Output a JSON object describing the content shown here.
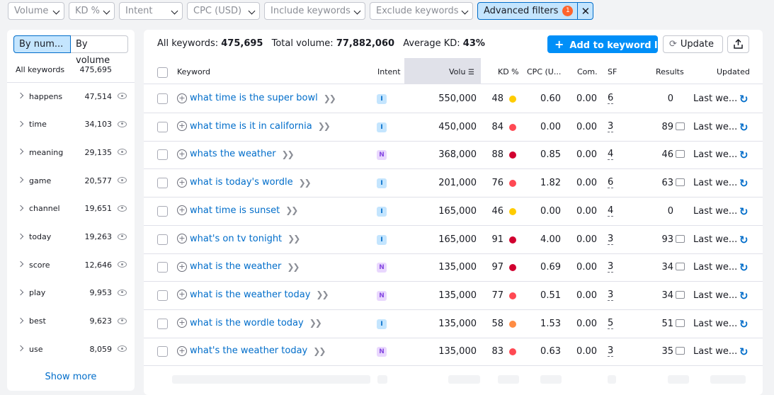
{
  "filters": {
    "volume": "Volume",
    "kd": "KD %",
    "intent": "Intent",
    "cpc": "CPC (USD)",
    "include": "Include keywords",
    "exclude": "Exclude keywords",
    "advanced": "Advanced filters",
    "advanced_count": "1"
  },
  "sidebar": {
    "by_number": "By num...",
    "by_volume": "By volume",
    "all_label": "All keywords",
    "all_count": "475,695",
    "groups": [
      {
        "name": "happens",
        "count": "47,514"
      },
      {
        "name": "time",
        "count": "34,103"
      },
      {
        "name": "meaning",
        "count": "29,135"
      },
      {
        "name": "game",
        "count": "20,577"
      },
      {
        "name": "channel",
        "count": "19,651"
      },
      {
        "name": "today",
        "count": "19,263"
      },
      {
        "name": "score",
        "count": "12,646"
      },
      {
        "name": "play",
        "count": "9,953"
      },
      {
        "name": "best",
        "count": "9,623"
      },
      {
        "name": "use",
        "count": "8,059"
      }
    ],
    "show_more": "Show more"
  },
  "summary": {
    "all_label": "All keywords:",
    "all_value": "475,695",
    "vol_label": "Total volume:",
    "vol_value": "77,882,060",
    "kd_label": "Average KD:",
    "kd_value": "43%"
  },
  "toolbar": {
    "add": "Add to keyword list",
    "update": "Update"
  },
  "columns": {
    "keyword": "Keyword",
    "intent": "Intent",
    "volume": "Volu",
    "kd": "KD %",
    "cpc": "CPC (U...",
    "com": "Com.",
    "sf": "SF",
    "results": "Results",
    "updated": "Updated"
  },
  "colors": {
    "green": "#008ff8",
    "kd_yellow": "#ffcc00",
    "kd_orange": "#ff8c43",
    "kd_red": "#ff4953",
    "kd_darkred": "#d1002f"
  },
  "rows": [
    {
      "keyword": "what time is the super bowl",
      "intent": "I",
      "volume": "550,000",
      "kd": "48",
      "kd_color": "#ffcc00",
      "cpc": "0.60",
      "com": "0.00",
      "sf": "6",
      "results": "0",
      "results_icon": false,
      "updated": "Last we..."
    },
    {
      "keyword": "what time is it in california",
      "intent": "I",
      "volume": "450,000",
      "kd": "84",
      "kd_color": "#ff4953",
      "cpc": "0.00",
      "com": "0.00",
      "sf": "3",
      "results": "89",
      "results_icon": true,
      "updated": "Last we..."
    },
    {
      "keyword": "whats the weather",
      "intent": "N",
      "volume": "368,000",
      "kd": "88",
      "kd_color": "#d1002f",
      "cpc": "0.85",
      "com": "0.00",
      "sf": "4",
      "results": "46",
      "results_icon": true,
      "updated": "Last we..."
    },
    {
      "keyword": "what is today's wordle",
      "intent": "I",
      "volume": "201,000",
      "kd": "76",
      "kd_color": "#ff4953",
      "cpc": "1.82",
      "com": "0.00",
      "sf": "6",
      "results": "63",
      "results_icon": true,
      "updated": "Last we..."
    },
    {
      "keyword": "what time is sunset",
      "intent": "I",
      "volume": "165,000",
      "kd": "46",
      "kd_color": "#ffcc00",
      "cpc": "0.00",
      "com": "0.00",
      "sf": "4",
      "results": "0",
      "results_icon": false,
      "updated": "Last we..."
    },
    {
      "keyword": "what's on tv tonight",
      "intent": "I",
      "volume": "165,000",
      "kd": "91",
      "kd_color": "#d1002f",
      "cpc": "4.00",
      "com": "0.00",
      "sf": "3",
      "results": "93",
      "results_icon": true,
      "updated": "Last we..."
    },
    {
      "keyword": "what is the weather",
      "intent": "N",
      "volume": "135,000",
      "kd": "97",
      "kd_color": "#d1002f",
      "cpc": "0.69",
      "com": "0.00",
      "sf": "3",
      "results": "34",
      "results_icon": true,
      "updated": "Last we..."
    },
    {
      "keyword": "what is the weather today",
      "intent": "N",
      "volume": "135,000",
      "kd": "77",
      "kd_color": "#ff4953",
      "cpc": "0.51",
      "com": "0.00",
      "sf": "3",
      "results": "34",
      "results_icon": true,
      "updated": "Last we..."
    },
    {
      "keyword": "what is the wordle today",
      "intent": "I",
      "volume": "135,000",
      "kd": "58",
      "kd_color": "#ff8c43",
      "cpc": "1.53",
      "com": "0.00",
      "sf": "5",
      "results": "51",
      "results_icon": true,
      "updated": "Last we..."
    },
    {
      "keyword": "what's the weather today",
      "intent": "N",
      "volume": "135,000",
      "kd": "83",
      "kd_color": "#ff4953",
      "cpc": "0.63",
      "com": "0.00",
      "sf": "3",
      "results": "35",
      "results_icon": true,
      "updated": "Last we..."
    }
  ]
}
